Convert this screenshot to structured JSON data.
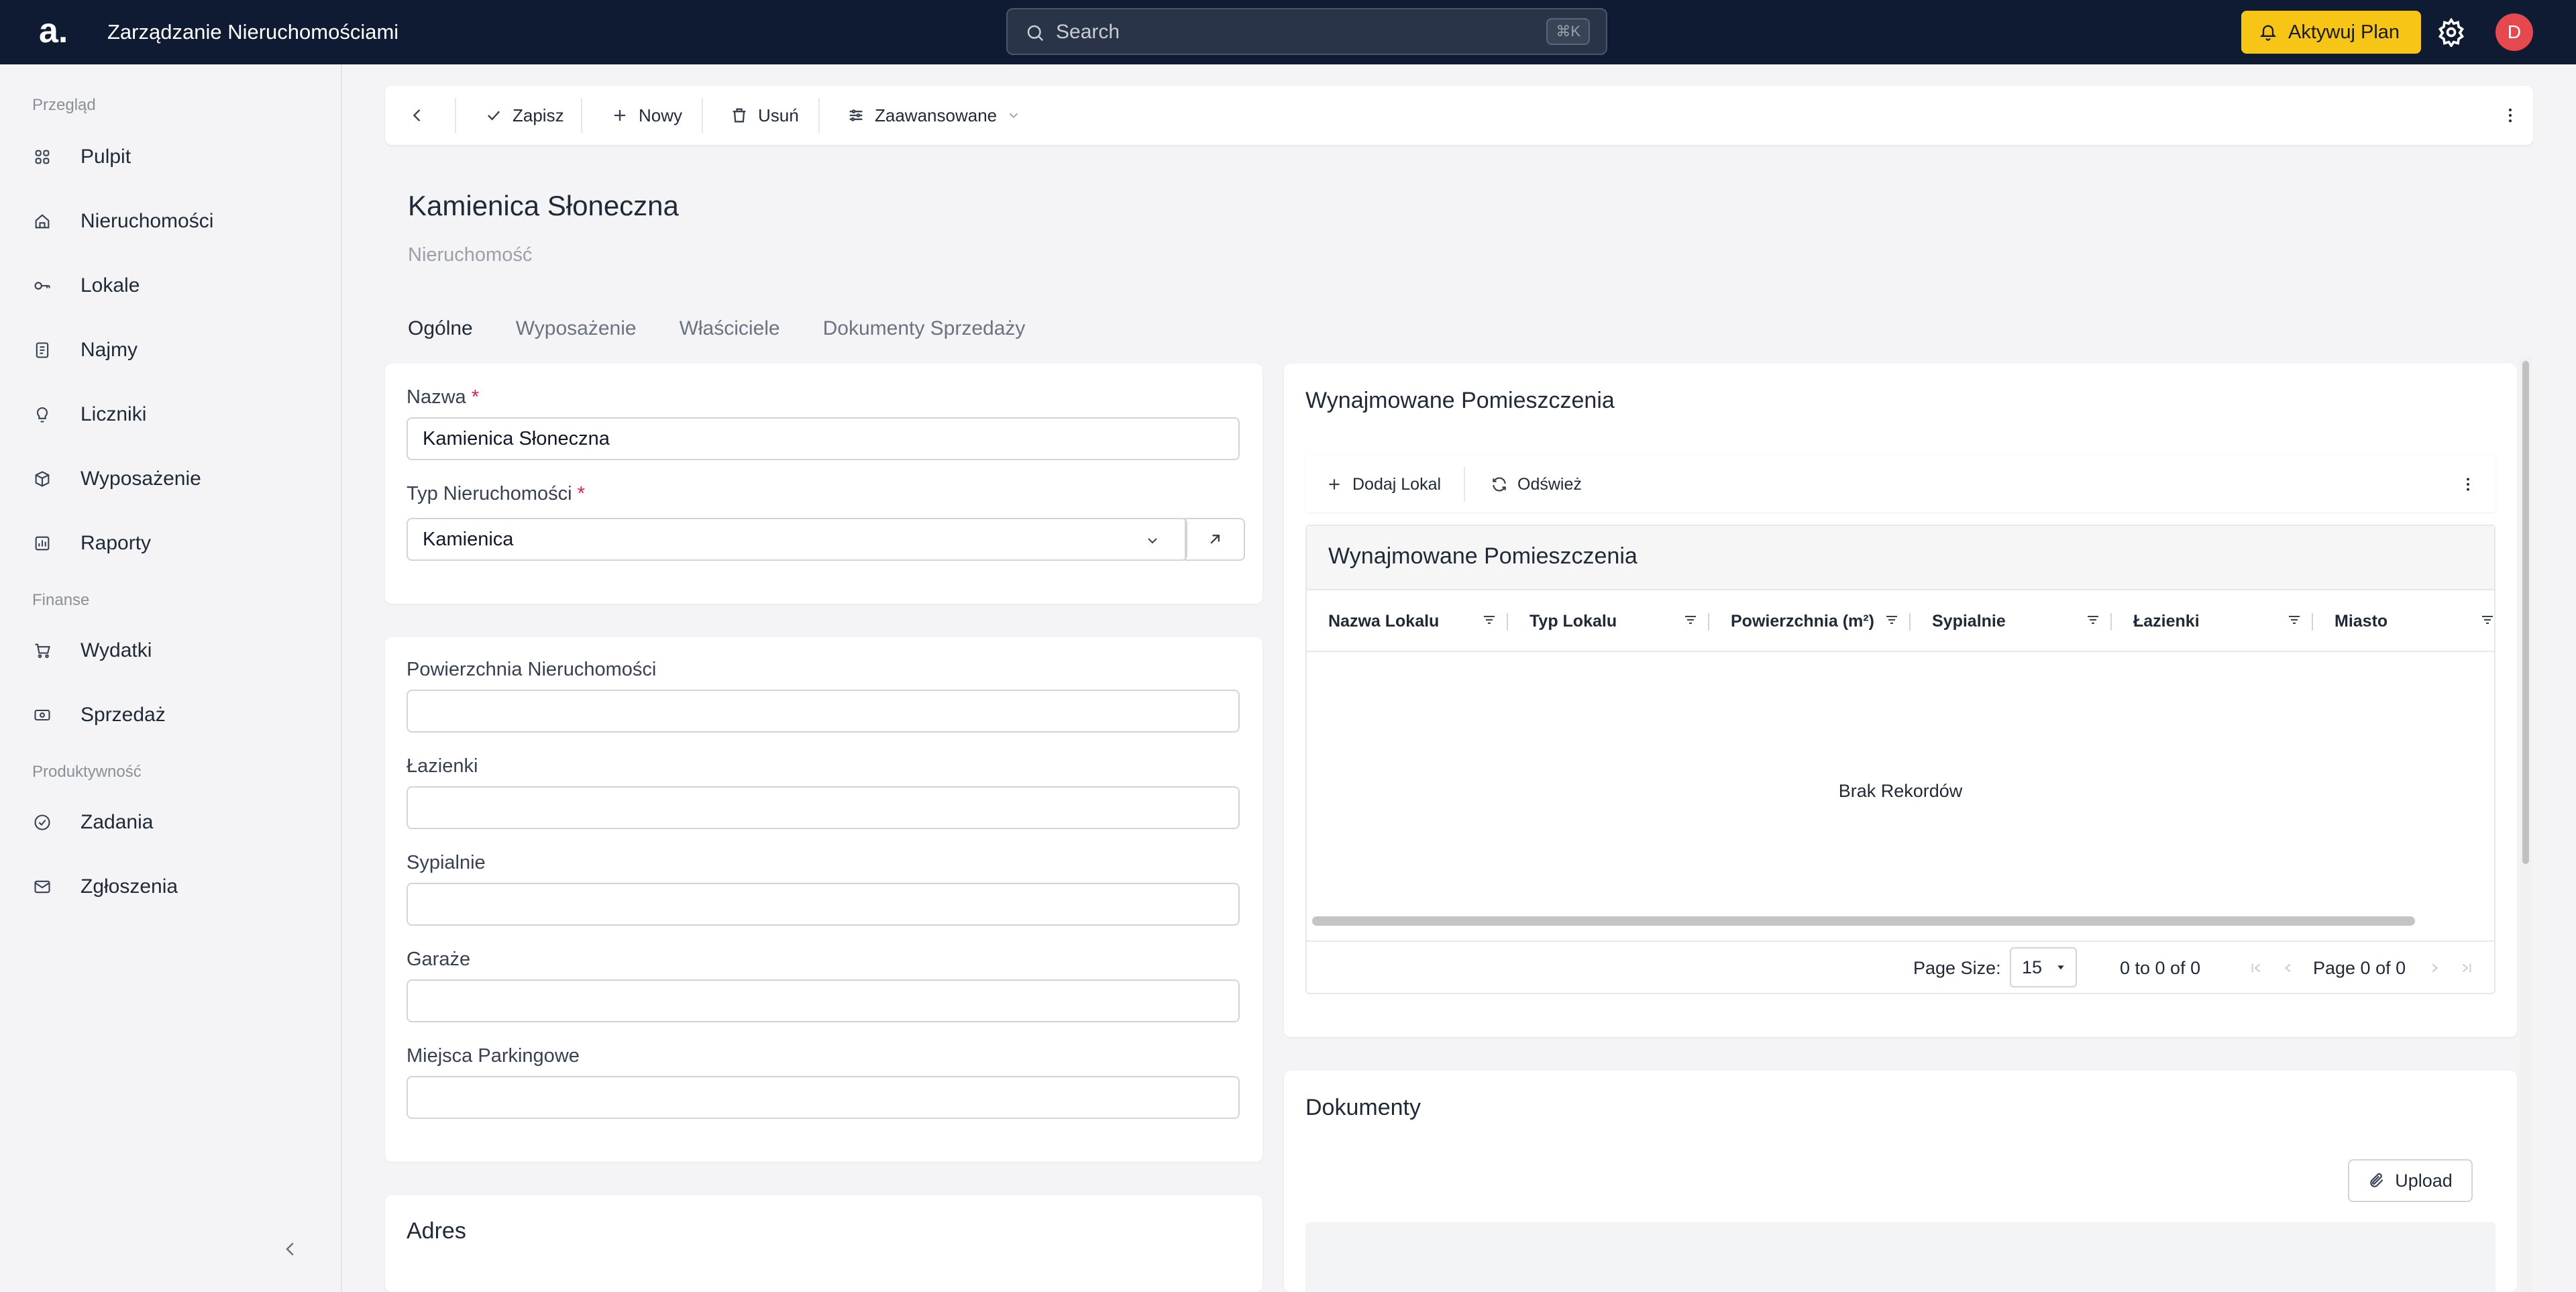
{
  "topbar": {
    "logo": "a.",
    "app_title": "Zarządzanie Nieruchomościami",
    "search_placeholder": "Search",
    "search_shortcut": "⌘K",
    "upgrade_label": "Aktywuj Plan",
    "avatar_initial": "D"
  },
  "sidebar": {
    "sections": [
      "Przegląd",
      "Finanse",
      "Produktywność"
    ],
    "items": [
      {
        "label": "Pulpit",
        "icon": "grid-icon"
      },
      {
        "label": "Nieruchomości",
        "icon": "house-icon"
      },
      {
        "label": "Lokale",
        "icon": "key-icon"
      },
      {
        "label": "Najmy",
        "icon": "document-icon"
      },
      {
        "label": "Liczniki",
        "icon": "bulb-icon"
      },
      {
        "label": "Wyposażenie",
        "icon": "box-icon"
      },
      {
        "label": "Raporty",
        "icon": "report-icon"
      },
      {
        "label": "Wydatki",
        "icon": "cart-icon"
      },
      {
        "label": "Sprzedaż",
        "icon": "cash-icon"
      },
      {
        "label": "Zadania",
        "icon": "check-circle-icon"
      },
      {
        "label": "Zgłoszenia",
        "icon": "mail-icon"
      }
    ]
  },
  "toolbar": {
    "save_label": "Zapisz",
    "new_label": "Nowy",
    "delete_label": "Usuń",
    "advanced_label": "Zaawansowane"
  },
  "page": {
    "title": "Kamienica Słoneczna",
    "subtitle": "Nieruchomość",
    "tabs": [
      "Ogólne",
      "Wyposażenie",
      "Właściciele",
      "Dokumenty Sprzedaży"
    ],
    "active_tab": "Ogólne"
  },
  "form": {
    "name_label": "Nazwa",
    "name_value": "Kamienica Słoneczna",
    "type_label": "Typ Nieruchomości",
    "type_value": "Kamienica",
    "area_label": "Powierzchnia Nieruchomości",
    "bathrooms_label": "Łazienki",
    "bedrooms_label": "Sypialnie",
    "garages_label": "Garaże",
    "parking_label": "Miejsca Parkingowe",
    "address_title": "Adres"
  },
  "rented": {
    "title": "Wynajmowane Pomieszczenia",
    "add_label": "Dodaj Lokal",
    "refresh_label": "Odśwież",
    "grid_title": "Wynajmowane Pomieszczenia",
    "columns": [
      "Nazwa Lokalu",
      "Typ Lokalu",
      "Powierzchnia (m²)",
      "Sypialnie",
      "Łazienki",
      "Miasto"
    ],
    "empty_text": "Brak Rekordów",
    "page_size_label": "Page Size:",
    "page_size_value": "15",
    "range_text": "0 to 0 of 0",
    "page_text": "Page 0 of 0"
  },
  "documents": {
    "title": "Dokumenty",
    "upload_label": "Upload"
  },
  "colors": {
    "topbar": "#0f1b33",
    "accent": "#f7c516",
    "avatar": "#e5484d",
    "required": "#e11d48"
  }
}
